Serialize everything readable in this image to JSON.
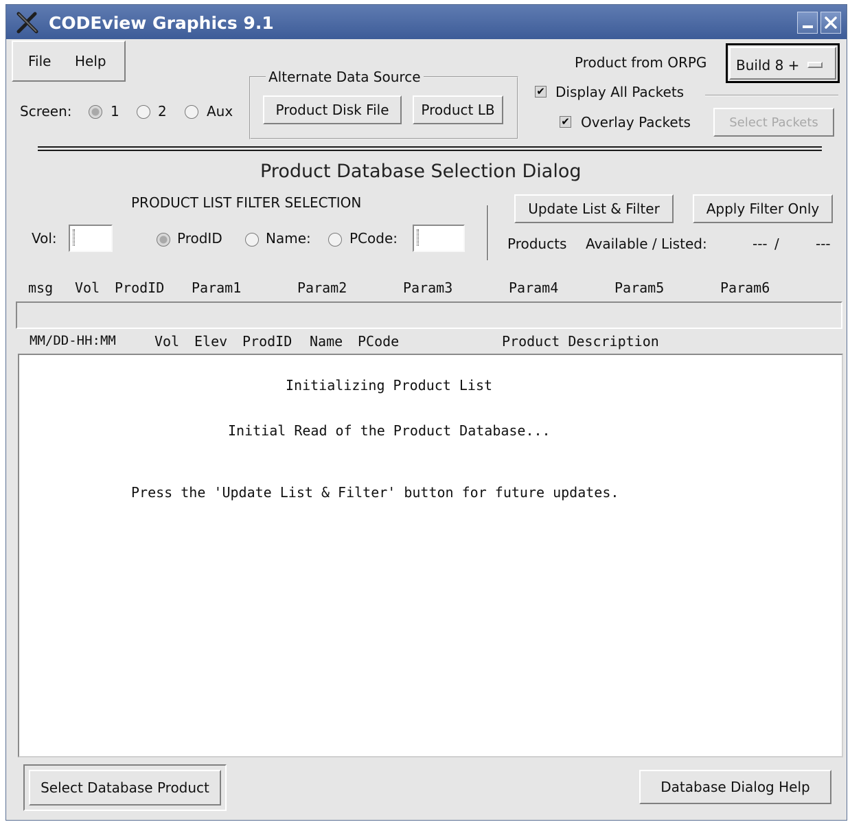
{
  "window": {
    "title": "CODEview Graphics 9.1",
    "minimize_glyph": "_",
    "close_glyph": "✕"
  },
  "menu": {
    "file": "File",
    "help": "Help"
  },
  "screen": {
    "label": "Screen:",
    "options": [
      "1",
      "2",
      "Aux"
    ],
    "selected": "1"
  },
  "alt_source": {
    "legend": "Alternate Data Source",
    "disk_button": "Product Disk File",
    "lb_button": "Product LB"
  },
  "orpg": {
    "label": "Product from ORPG",
    "build_value": "Build 8 +",
    "display_all_packets": "Display All Packets",
    "overlay_packets": "Overlay Packets",
    "select_packets": "Select Packets"
  },
  "dialog": {
    "title": "Product Database Selection Dialog"
  },
  "filter": {
    "heading": "PRODUCT LIST FILTER SELECTION",
    "vol_label": "Vol:",
    "vol_value": "",
    "prodid_label": "ProdID",
    "name_label": "Name:",
    "pcode_label": "PCode:",
    "pcode_value": "",
    "update_button": "Update List & Filter",
    "apply_button": "Apply Filter Only",
    "products_label": "Products",
    "available_label": "Available / Listed:",
    "available_value": "---",
    "separator": "/",
    "listed_value": "---"
  },
  "param_header": [
    "msg",
    "Vol",
    "ProdID",
    "Param1",
    "Param2",
    "Param3",
    "Param4",
    "Param5",
    "Param6"
  ],
  "list_header": [
    "MM/DD-HH:MM",
    "Vol",
    "Elev",
    "ProdID",
    "Name",
    "PCode",
    "Product Description"
  ],
  "list_messages": {
    "line1": "Initializing Product List",
    "line2": "Initial Read of the Product Database...",
    "line3": "Press the 'Update List & Filter' button for future updates."
  },
  "bottom": {
    "select_button": "Select Database Product",
    "help_button": "Database Dialog Help"
  },
  "colors": {
    "titlebar": "#4a67a3",
    "window_bg": "#e6e6e6"
  },
  "icons": {
    "app": "x-logo-icon"
  }
}
